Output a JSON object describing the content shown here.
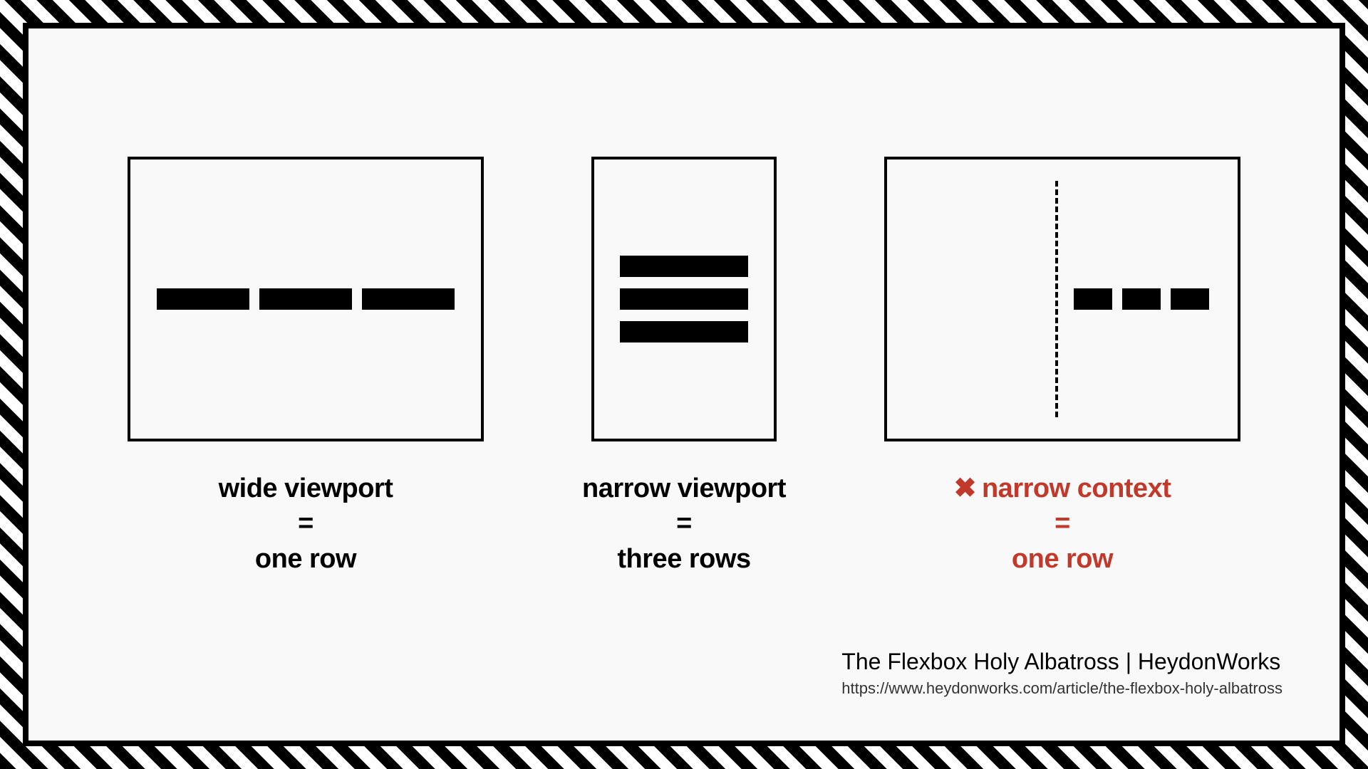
{
  "columns": {
    "wide": {
      "line1": "wide viewport",
      "eq": "=",
      "line2": "one row"
    },
    "narrow": {
      "line1": "narrow viewport",
      "eq": "=",
      "line2": "three rows"
    },
    "context": {
      "cross": "✖",
      "line1": "narrow context",
      "eq": "=",
      "line2": "one row"
    }
  },
  "credit": {
    "title": "The Flexbox Holy Albatross | HeydonWorks",
    "url": "https://www.heydonworks.com/article/the-flexbox-holy-albatross"
  }
}
